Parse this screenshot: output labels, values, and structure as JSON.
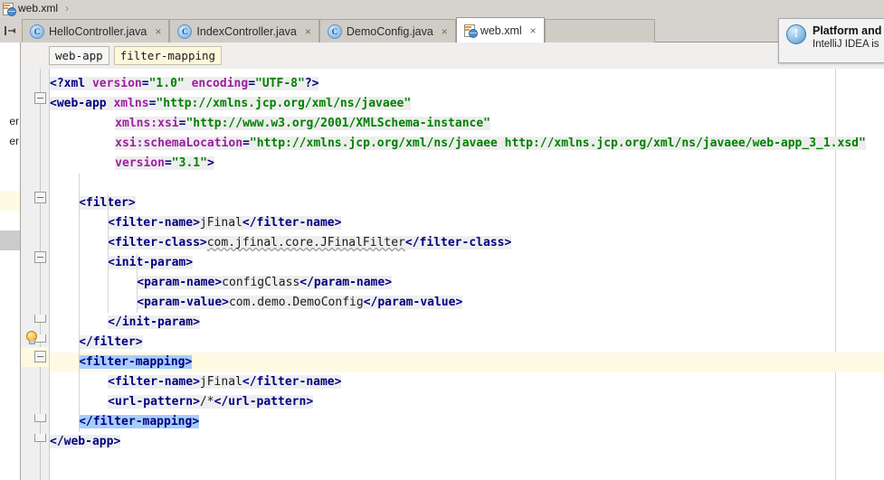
{
  "window": {
    "breadcrumb": {
      "file": "web.xml",
      "icon": "xml-file-icon",
      "separator": "›"
    }
  },
  "tabbar": {
    "collapse_icon": "hide-panel-icon",
    "tabs": [
      {
        "label": "HelloController.java",
        "icon": "java-class-icon",
        "close": "×",
        "active": false
      },
      {
        "label": "IndexController.java",
        "icon": "java-class-icon",
        "close": "×",
        "active": false
      },
      {
        "label": "DemoConfig.java",
        "icon": "java-class-icon",
        "close": "×",
        "active": false
      },
      {
        "label": "web.xml",
        "icon": "xml-file-icon",
        "close": "×",
        "active": true
      }
    ]
  },
  "project_sliver": {
    "items": [
      {
        "label": "er",
        "state": "normal"
      },
      {
        "label": "er",
        "state": "normal"
      },
      {
        "label": "",
        "state": "highlight-yellow"
      },
      {
        "label": "",
        "state": "selected"
      }
    ]
  },
  "editor": {
    "tag_path": [
      {
        "label": "web-app",
        "selected": false
      },
      {
        "label": "filter-mapping",
        "selected": true
      }
    ],
    "colors": {
      "tag_name": "#000080",
      "attribute_name": "#9b1fa0",
      "attribute_value": "#008000",
      "tag_background": "#eeeeee",
      "selection_highlight": "#a8cdfb",
      "current_line": "#fdf9e2",
      "gutter_background": "#efefef"
    },
    "gutter": {
      "fold_markers": [
        2,
        6,
        9,
        13,
        14,
        15,
        19,
        20
      ],
      "intention_bulb_line": 14
    },
    "current_line": 15,
    "lines": [
      {
        "n": 1,
        "indent": 0,
        "type": "prolog",
        "parts": [
          {
            "t": "brk",
            "v": "<?"
          },
          {
            "t": "tagname",
            "v": "xml"
          },
          {
            "t": "sp",
            "v": " "
          },
          {
            "t": "attr",
            "v": "version"
          },
          {
            "t": "eq",
            "v": "="
          },
          {
            "t": "val",
            "v": "\"1.0\""
          },
          {
            "t": "sp",
            "v": " "
          },
          {
            "t": "attr",
            "v": "encoding"
          },
          {
            "t": "eq",
            "v": "="
          },
          {
            "t": "val",
            "v": "\"UTF-8\""
          },
          {
            "t": "brk",
            "v": "?>"
          }
        ]
      },
      {
        "n": 2,
        "indent": 0,
        "type": "open",
        "parts": [
          {
            "t": "brk",
            "v": "<"
          },
          {
            "t": "tagname",
            "v": "web-app"
          },
          {
            "t": "sp",
            "v": " "
          },
          {
            "t": "attr",
            "v": "xmlns"
          },
          {
            "t": "eq",
            "v": "="
          },
          {
            "t": "val",
            "v": "\"http://xmlns.jcp.org/xml/ns/javaee\""
          }
        ]
      },
      {
        "n": 3,
        "indent": 9,
        "type": "attr",
        "parts": [
          {
            "t": "attr",
            "v": "xmlns:xsi"
          },
          {
            "t": "eq",
            "v": "="
          },
          {
            "t": "val",
            "v": "\"http://www.w3.org/2001/XMLSchema-instance\""
          }
        ]
      },
      {
        "n": 4,
        "indent": 9,
        "type": "attr",
        "parts": [
          {
            "t": "attr",
            "v": "xsi:schemaLocation"
          },
          {
            "t": "eq",
            "v": "="
          },
          {
            "t": "val",
            "v": "\"http://xmlns.jcp.org/xml/ns/javaee http://xmlns.jcp.org/xml/ns/javaee/web-app_3_1.xsd\""
          }
        ]
      },
      {
        "n": 5,
        "indent": 9,
        "type": "attr",
        "parts": [
          {
            "t": "attr",
            "v": "version"
          },
          {
            "t": "eq",
            "v": "="
          },
          {
            "t": "val",
            "v": "\"3.1\""
          },
          {
            "t": "brk",
            "v": ">"
          }
        ]
      },
      {
        "n": 6,
        "indent": 0,
        "type": "blank",
        "parts": []
      },
      {
        "n": 7,
        "indent": 4,
        "type": "open",
        "parts": [
          {
            "t": "brk",
            "v": "<"
          },
          {
            "t": "tagname",
            "v": "filter"
          },
          {
            "t": "brk",
            "v": ">"
          }
        ]
      },
      {
        "n": 8,
        "indent": 8,
        "type": "leaf",
        "parts": [
          {
            "t": "brk",
            "v": "<"
          },
          {
            "t": "tagname",
            "v": "filter-name"
          },
          {
            "t": "brk",
            "v": ">"
          },
          {
            "t": "txt",
            "v": "jFinal"
          },
          {
            "t": "brk",
            "v": "</"
          },
          {
            "t": "tagname",
            "v": "filter-name"
          },
          {
            "t": "brk",
            "v": ">"
          }
        ]
      },
      {
        "n": 9,
        "indent": 8,
        "type": "leaf",
        "parts": [
          {
            "t": "brk",
            "v": "<"
          },
          {
            "t": "tagname",
            "v": "filter-class"
          },
          {
            "t": "brk",
            "v": ">"
          },
          {
            "t": "txt-squiggle",
            "v": "com.jfinal.core.JFinalFilter"
          },
          {
            "t": "brk",
            "v": "</"
          },
          {
            "t": "tagname",
            "v": "filter-class"
          },
          {
            "t": "brk",
            "v": ">"
          }
        ]
      },
      {
        "n": 10,
        "indent": 8,
        "type": "open",
        "parts": [
          {
            "t": "brk",
            "v": "<"
          },
          {
            "t": "tagname",
            "v": "init-param"
          },
          {
            "t": "brk",
            "v": ">"
          }
        ]
      },
      {
        "n": 11,
        "indent": 12,
        "type": "leaf",
        "parts": [
          {
            "t": "brk",
            "v": "<"
          },
          {
            "t": "tagname",
            "v": "param-name"
          },
          {
            "t": "brk",
            "v": ">"
          },
          {
            "t": "txt",
            "v": "configClass"
          },
          {
            "t": "brk",
            "v": "</"
          },
          {
            "t": "tagname",
            "v": "param-name"
          },
          {
            "t": "brk",
            "v": ">"
          }
        ]
      },
      {
        "n": 12,
        "indent": 12,
        "type": "leaf",
        "parts": [
          {
            "t": "brk",
            "v": "<"
          },
          {
            "t": "tagname",
            "v": "param-value"
          },
          {
            "t": "brk",
            "v": ">"
          },
          {
            "t": "txt",
            "v": "com.demo.DemoConfig"
          },
          {
            "t": "brk",
            "v": "</"
          },
          {
            "t": "tagname",
            "v": "param-value"
          },
          {
            "t": "brk",
            "v": ">"
          }
        ]
      },
      {
        "n": 13,
        "indent": 8,
        "type": "close",
        "parts": [
          {
            "t": "brk",
            "v": "</"
          },
          {
            "t": "tagname",
            "v": "init-param"
          },
          {
            "t": "brk",
            "v": ">"
          }
        ]
      },
      {
        "n": 14,
        "indent": 4,
        "type": "close",
        "parts": [
          {
            "t": "brk",
            "v": "</"
          },
          {
            "t": "tagname",
            "v": "filter"
          },
          {
            "t": "brk",
            "v": ">"
          }
        ]
      },
      {
        "n": 15,
        "indent": 4,
        "type": "open-selected",
        "parts": [
          {
            "t": "brk",
            "v": "<"
          },
          {
            "t": "tagname",
            "v": "filter-mapping"
          },
          {
            "t": "brk",
            "v": ">"
          }
        ]
      },
      {
        "n": 16,
        "indent": 8,
        "type": "leaf",
        "parts": [
          {
            "t": "brk",
            "v": "<"
          },
          {
            "t": "tagname",
            "v": "filter-name"
          },
          {
            "t": "brk",
            "v": ">"
          },
          {
            "t": "txt",
            "v": "jFinal"
          },
          {
            "t": "brk",
            "v": "</"
          },
          {
            "t": "tagname",
            "v": "filter-name"
          },
          {
            "t": "brk",
            "v": ">"
          }
        ]
      },
      {
        "n": 17,
        "indent": 8,
        "type": "leaf",
        "parts": [
          {
            "t": "brk",
            "v": "<"
          },
          {
            "t": "tagname",
            "v": "url-pattern"
          },
          {
            "t": "brk",
            "v": ">"
          },
          {
            "t": "txt",
            "v": "/*"
          },
          {
            "t": "brk",
            "v": "</"
          },
          {
            "t": "tagname",
            "v": "url-pattern"
          },
          {
            "t": "brk",
            "v": ">"
          }
        ]
      },
      {
        "n": 18,
        "indent": 4,
        "type": "close-selected",
        "parts": [
          {
            "t": "brk",
            "v": "</"
          },
          {
            "t": "tagname",
            "v": "filter-mapping"
          },
          {
            "t": "brk",
            "v": ">"
          }
        ]
      },
      {
        "n": 19,
        "indent": 0,
        "type": "close",
        "parts": [
          {
            "t": "brk",
            "v": "</"
          },
          {
            "t": "tagname",
            "v": "web-app"
          },
          {
            "t": "brk",
            "v": ">"
          }
        ]
      }
    ]
  },
  "notification": {
    "icon": "info-icon",
    "title": "Platform and",
    "body": "IntelliJ IDEA is"
  }
}
